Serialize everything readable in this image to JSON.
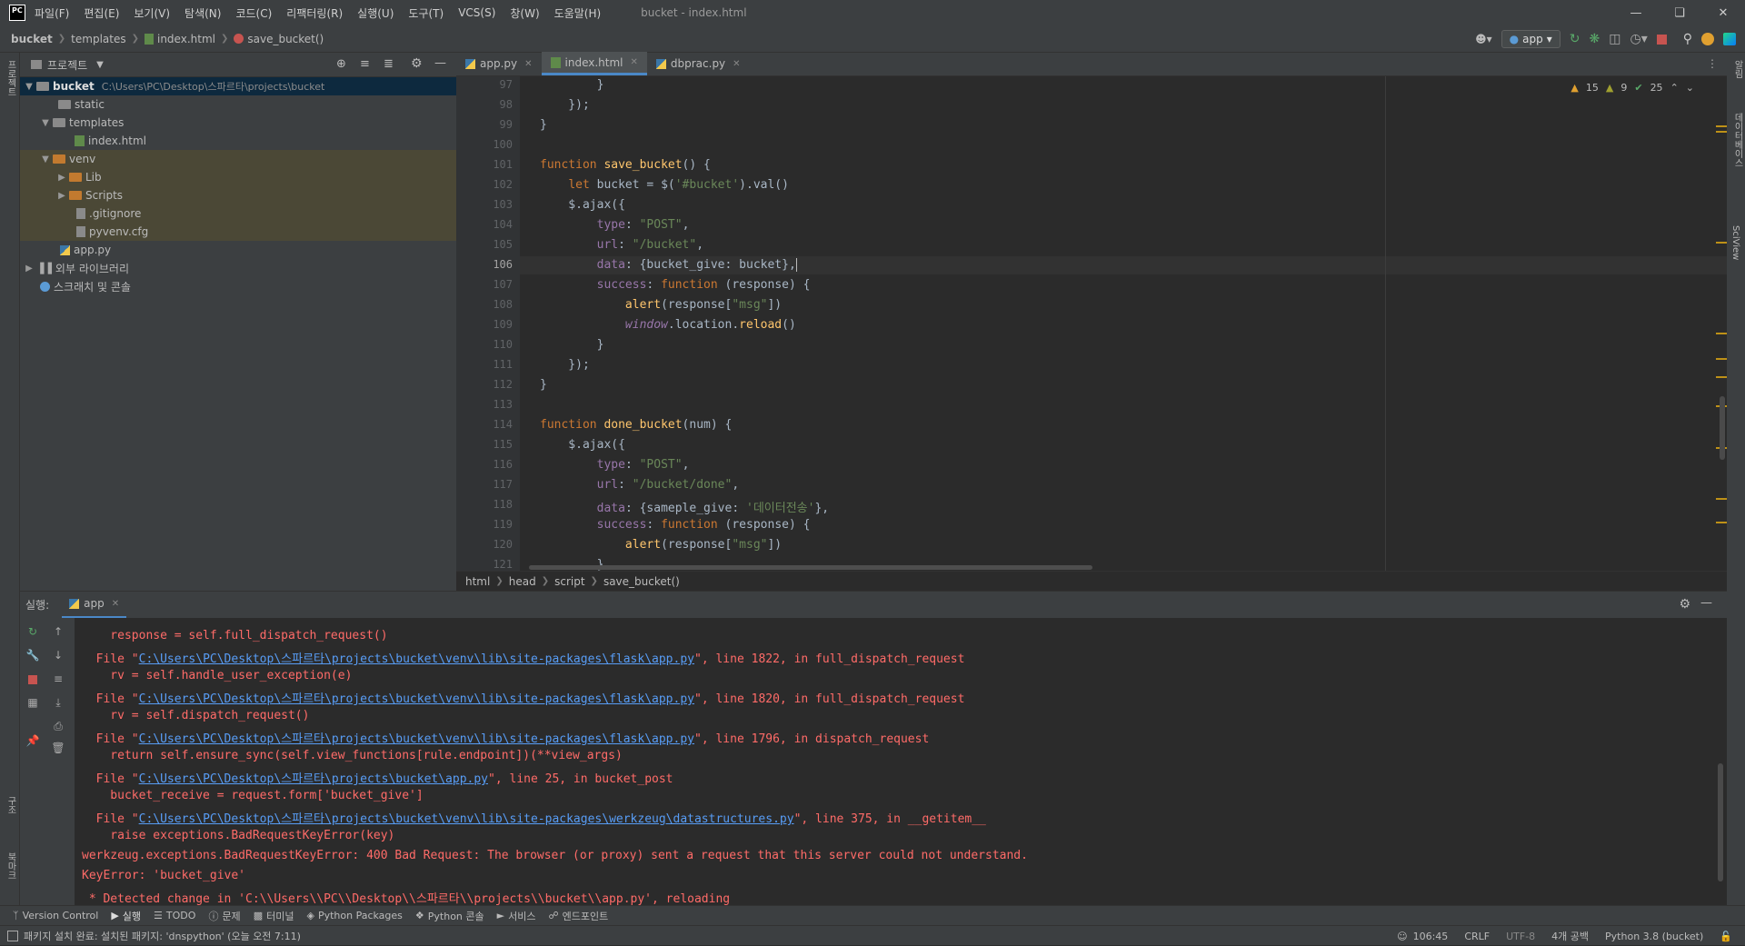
{
  "menubar": {
    "logo": "PC",
    "items": [
      "파일(F)",
      "편집(E)",
      "보기(V)",
      "탐색(N)",
      "코드(C)",
      "리팩터링(R)",
      "실행(U)",
      "도구(T)",
      "VCS(S)",
      "창(W)",
      "도움말(H)"
    ],
    "title": "bucket - index.html"
  },
  "navbar": {
    "crumbs": [
      "bucket",
      "templates",
      "index.html",
      "save_bucket()"
    ],
    "run_config": "app"
  },
  "project": {
    "title": "프로젝트",
    "root": "bucket",
    "root_path": "C:\\Users\\PC\\Desktop\\스파르타\\projects\\bucket",
    "items": [
      "static",
      "templates",
      "index.html",
      "venv",
      "Lib",
      "Scripts",
      ".gitignore",
      "pyvenv.cfg",
      "app.py",
      "외부 라이브러리",
      "스크래치 및 콘솔"
    ]
  },
  "tabs": [
    "app.py",
    "index.html",
    "dbprac.py"
  ],
  "inspections": {
    "warnings": "15",
    "weak": "9",
    "ok": "25"
  },
  "code": {
    "line_numbers": [
      "97",
      "98",
      "99",
      "100",
      "101",
      "102",
      "103",
      "104",
      "105",
      "106",
      "107",
      "108",
      "109",
      "110",
      "111",
      "112",
      "113",
      "114",
      "115",
      "116",
      "117",
      "118",
      "119",
      "120",
      "121"
    ]
  },
  "editor_breadcrumb": [
    "html",
    "head",
    "script",
    "save_bucket()"
  ],
  "run": {
    "label": "실행:",
    "tab": "app",
    "lines": [
      "    response = self.full_dispatch_request()",
      "  File \"",
      "    rv = self.handle_user_exception(e)",
      "  File \"",
      "    rv = self.dispatch_request()",
      "  File \"",
      "    return self.ensure_sync(self.view_functions[rule.endpoint])(**view_args)",
      "  File \"",
      "    bucket_receive = request.form['bucket_give']",
      "  File \"",
      "    raise exceptions.BadRequestKeyError(key)",
      "werkzeug.exceptions.BadRequestKeyError: 400 Bad Request: The browser (or proxy) sent a request that this server could not understand.",
      "KeyError: 'bucket_give'",
      " * Detected change in 'C:\\\\Users\\\\PC\\\\Desktop\\\\스파르타\\\\projects\\\\bucket\\\\app.py', reloading"
    ],
    "links": [
      "C:\\Users\\PC\\Desktop\\스파르타\\projects\\bucket\\venv\\lib\\site-packages\\flask\\app.py",
      "C:\\Users\\PC\\Desktop\\스파르타\\projects\\bucket\\venv\\lib\\site-packages\\flask\\app.py",
      "C:\\Users\\PC\\Desktop\\스파르타\\projects\\bucket\\venv\\lib\\site-packages\\flask\\app.py",
      "C:\\Users\\PC\\Desktop\\스파르타\\projects\\bucket\\app.py",
      "C:\\Users\\PC\\Desktop\\스파르타\\projects\\bucket\\venv\\lib\\site-packages\\werkzeug\\datastructures.py"
    ],
    "tails": [
      "\", line 1822, in full_dispatch_request",
      "\", line 1820, in full_dispatch_request",
      "\", line 1796, in dispatch_request",
      "\", line 25, in bucket_post",
      "\", line 375, in __getitem__"
    ]
  },
  "bottom_tabs": [
    "Version Control",
    "실행",
    "TODO",
    "문제",
    "터미널",
    "Python Packages",
    "Python 콘솔",
    "서비스",
    "엔드포인트"
  ],
  "status": {
    "message": "패키지 설치 완료: 설치된 패키지: 'dnspython' (오늘 오전 7:11)",
    "position": "106:45",
    "line_sep": "CRLF",
    "encoding": "UTF-8",
    "indent": "4개 공백",
    "interpreter": "Python 3.8 (bucket)"
  },
  "side_tabs": {
    "left_top": "프로젝트",
    "left_mid": "구조",
    "left_bottom": "북마크",
    "right_1": "알림",
    "right_2": "데이터베이스",
    "right_3": "SciView"
  },
  "colors": {
    "accent": "#4a88c7",
    "error": "#ff6b68",
    "link": "#589df6",
    "keyword": "#cc7832",
    "string": "#6a8759"
  }
}
